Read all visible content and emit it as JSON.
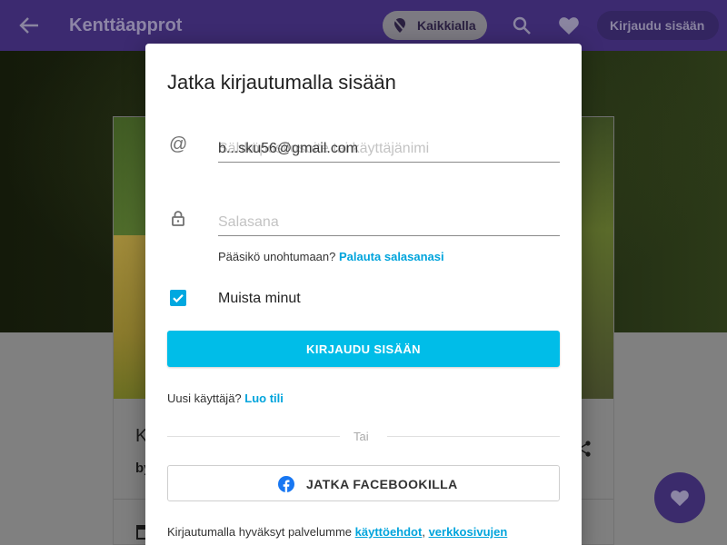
{
  "app_bar": {
    "title": "Kenttäapprot",
    "location_chip_label": "Kaikkialla",
    "login_label": "Kirjaudu sisään"
  },
  "background_card": {
    "title_fragment": "K",
    "byline_fragment": "by"
  },
  "login_dialog": {
    "title": "Jatka kirjautumalla sisään",
    "email_field": {
      "placeholder": "Sähköpostiosoite tai käyttäjänimi",
      "value": "b...sku56@gmail.com"
    },
    "password_field": {
      "placeholder": "Salasana"
    },
    "forgot_text": "Pääsikö unohtumaan?",
    "reset_link": "Palauta salasanasi",
    "remember_label": "Muista minut",
    "remember_checked": true,
    "login_button": "KIRJAUDU SISÄÄN",
    "new_user_text": "Uusi käyttäjä?",
    "create_account_link": "Luo tili",
    "separator": "Tai",
    "facebook_button": "JATKA FACEBOOKILLA",
    "terms_text": "Kirjautumalla hyväksyt palvelumme",
    "terms_link": "käyttöehdot",
    "terms_comma": ",",
    "privacy_link": "verkkosivujen"
  },
  "colors": {
    "app_bar": "#3c2a70",
    "primary_button": "#00bde8",
    "link": "#00a4dc",
    "facebook": "#1877f2"
  },
  "icons": [
    "back-arrow-icon",
    "location-off-icon",
    "search-icon",
    "heart-icon",
    "at-sign-icon",
    "lock-icon",
    "checkbox-checked-icon",
    "facebook-icon",
    "share-icon",
    "calendar-icon"
  ]
}
